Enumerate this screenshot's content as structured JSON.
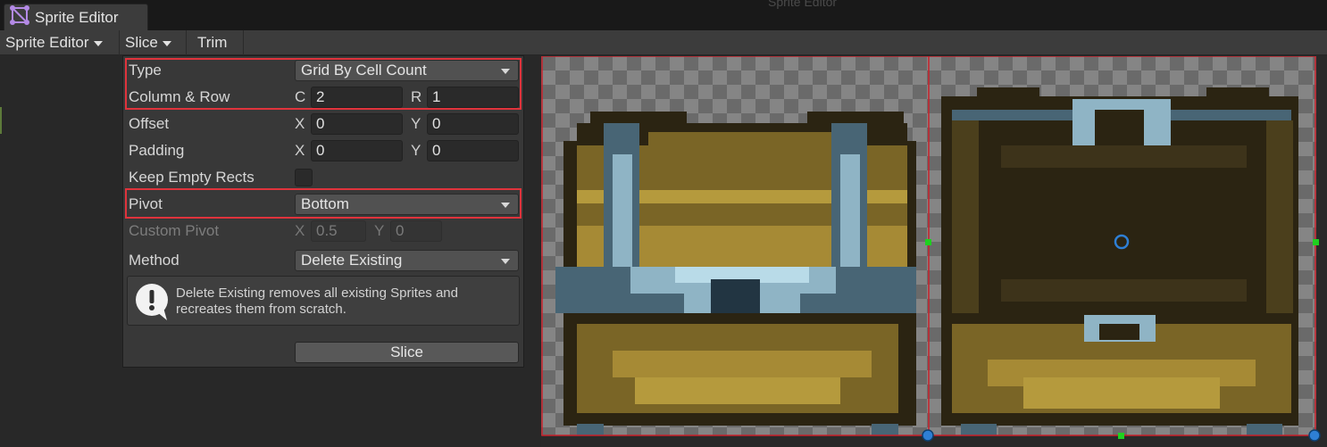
{
  "window": {
    "tab_title": "Sprite Editor",
    "background_label": "Sprite Editor",
    "icon": "sprite-editor-icon"
  },
  "toolbar": {
    "sprite_editor_menu": "Sprite Editor",
    "slice_menu": "Slice",
    "trim_button": "Trim"
  },
  "slice_panel": {
    "type": {
      "label": "Type",
      "value": "Grid By Cell Count"
    },
    "column_row": {
      "label": "Column & Row",
      "c_axis": "C",
      "c_value": "2",
      "r_axis": "R",
      "r_value": "1"
    },
    "offset": {
      "label": "Offset",
      "x_axis": "X",
      "x_value": "0",
      "y_axis": "Y",
      "y_value": "0"
    },
    "padding": {
      "label": "Padding",
      "x_axis": "X",
      "x_value": "0",
      "y_axis": "Y",
      "y_value": "0"
    },
    "keep_empty_rects": {
      "label": "Keep Empty Rects",
      "checked": false
    },
    "pivot": {
      "label": "Pivot",
      "value": "Bottom"
    },
    "custom_pivot": {
      "label": "Custom Pivot",
      "x_axis": "X",
      "x_value": "0.5",
      "y_axis": "Y",
      "y_value": "0",
      "enabled": false
    },
    "method": {
      "label": "Method",
      "value": "Delete Existing"
    },
    "help_text": "Delete Existing removes all existing Sprites and recreates them from scratch.",
    "slice_button": "Slice"
  },
  "colors": {
    "highlight": "#e0333c",
    "panel_bg": "#383838",
    "slice_line": "#c8202a",
    "handle_green": "#1fd01f",
    "pivot_blue": "#2e7fd4"
  }
}
